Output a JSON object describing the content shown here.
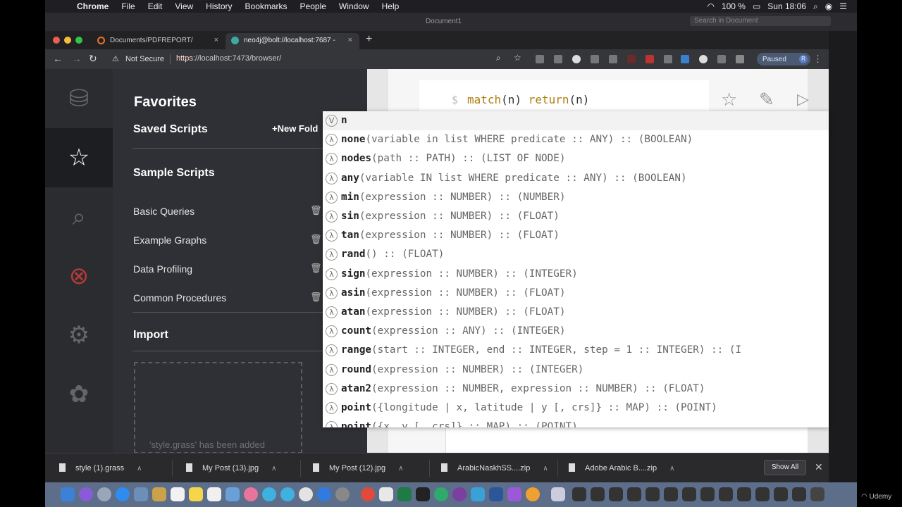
{
  "menubar": {
    "app": "Chrome",
    "items": [
      "File",
      "Edit",
      "View",
      "History",
      "Bookmarks",
      "People",
      "Window",
      "Help"
    ],
    "battery": "100 %",
    "clock": "Sun 18:06"
  },
  "underlying_window": {
    "title": "Document1",
    "search_placeholder": "Search in Document"
  },
  "tabs": [
    {
      "label": "Documents/PDFREPORT/",
      "active": false
    },
    {
      "label": "neo4j@bolt://localhost:7687 -",
      "active": true
    }
  ],
  "address": {
    "security": "Not Secure",
    "scheme": "https",
    "url_rest": "://localhost:7473/browser/"
  },
  "profile": {
    "status": "Paused",
    "initial": "R"
  },
  "drawer": {
    "title": "Favorites",
    "saved_scripts": "Saved Scripts",
    "new_folder": "+New Fold",
    "sample_scripts": "Sample Scripts",
    "items": [
      "Basic Queries",
      "Example Graphs",
      "Data Profiling",
      "Common Procedures"
    ],
    "import": "Import",
    "drop_message": "'style.grass' has been added"
  },
  "editor": {
    "prompt": "$",
    "keyword1": "match",
    "middle": "(n) ",
    "keyword2": "return",
    "tail": "(n)"
  },
  "autocomplete": [
    {
      "badge": "V",
      "name": "n",
      "sig": ""
    },
    {
      "badge": "λ",
      "name": "none",
      "sig": "(variable in list WHERE predicate :: ANY) :: (BOOLEAN)"
    },
    {
      "badge": "λ",
      "name": "nodes",
      "sig": "(path :: PATH) :: (LIST OF NODE)"
    },
    {
      "badge": "λ",
      "name": "any",
      "sig": "(variable IN list WHERE predicate :: ANY) :: (BOOLEAN)"
    },
    {
      "badge": "λ",
      "name": "min",
      "sig": "(expression :: NUMBER) :: (NUMBER)"
    },
    {
      "badge": "λ",
      "name": "sin",
      "sig": "(expression :: NUMBER) :: (FLOAT)"
    },
    {
      "badge": "λ",
      "name": "tan",
      "sig": "(expression :: NUMBER) :: (FLOAT)"
    },
    {
      "badge": "λ",
      "name": "rand",
      "sig": "() :: (FLOAT)"
    },
    {
      "badge": "λ",
      "name": "sign",
      "sig": "(expression :: NUMBER) :: (INTEGER)"
    },
    {
      "badge": "λ",
      "name": "asin",
      "sig": "(expression :: NUMBER) :: (FLOAT)"
    },
    {
      "badge": "λ",
      "name": "atan",
      "sig": "(expression :: NUMBER) :: (FLOAT)"
    },
    {
      "badge": "λ",
      "name": "count",
      "sig": "(expression :: ANY) :: (INTEGER)"
    },
    {
      "badge": "λ",
      "name": "range",
      "sig": "(start :: INTEGER, end :: INTEGER, step = 1 :: INTEGER) :: (I"
    },
    {
      "badge": "λ",
      "name": "round",
      "sig": "(expression :: NUMBER) :: (INTEGER)"
    },
    {
      "badge": "λ",
      "name": "atan2",
      "sig": "(expression :: NUMBER, expression :: NUMBER) :: (FLOAT)"
    },
    {
      "badge": "λ",
      "name": "point",
      "sig": "({longitude | x, latitude | y [, crs]} :: MAP) :: (POINT)"
    },
    {
      "badge": "λ",
      "name": "point",
      "sig": "({x, y [, crs]} :: MAP) :: (POINT)"
    }
  ],
  "downloads": {
    "files": [
      "style (1).grass",
      "My Post (13).jpg",
      "My Post (12).jpg",
      "ArabicNaskhSS....zip",
      "Adobe Arabic B....zip"
    ],
    "show_all": "Show All"
  },
  "watermark": "Udemy"
}
